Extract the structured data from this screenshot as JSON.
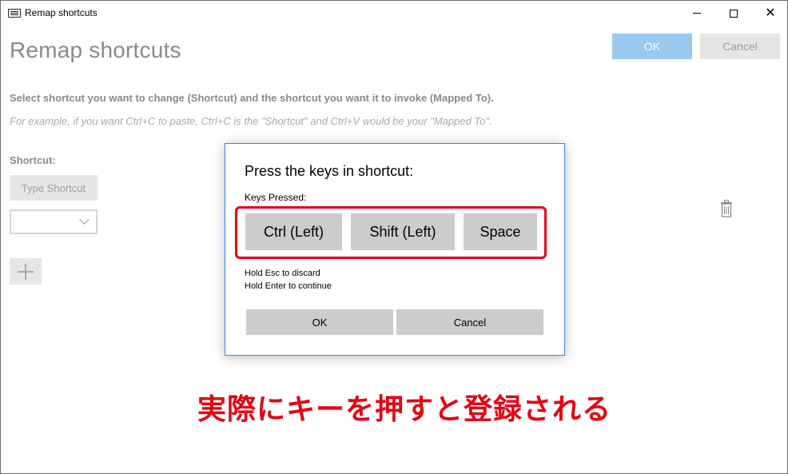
{
  "window": {
    "title": "Remap shortcuts",
    "icon": "keyboard-icon"
  },
  "page": {
    "title": "Remap shortcuts",
    "ok_label": "OK",
    "cancel_label": "Cancel",
    "instruction": "Select shortcut you want to change (Shortcut) and the shortcut you want it to invoke (Mapped To).",
    "example": "For example, if you want Ctrl+C to paste, Ctrl+C is the \"Shortcut\" and Ctrl+V would be your \"Mapped To\".",
    "shortcut_label": "Shortcut:",
    "type_shortcut_label": "Type Shortcut",
    "combo_value": ""
  },
  "dialog": {
    "title": "Press the keys in shortcut:",
    "keys_label": "Keys Pressed:",
    "keys": [
      "Ctrl (Left)",
      "Shift (Left)",
      "Space"
    ],
    "hint_discard": "Hold Esc to discard",
    "hint_continue": "Hold Enter to continue",
    "ok_label": "OK",
    "cancel_label": "Cancel"
  },
  "annotation": {
    "text": "実際にキーを押すと登録される",
    "color": "#e60012"
  },
  "colors": {
    "accent": "#99c9ef",
    "dialog_border": "#3b8ad9",
    "highlight": "#e60012"
  }
}
